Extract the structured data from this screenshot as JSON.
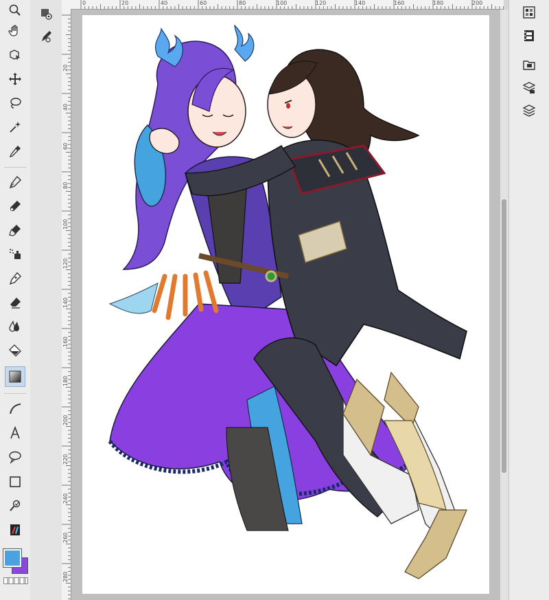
{
  "ruler": {
    "top_labels": [
      "0",
      "20",
      "40",
      "60",
      "80",
      "100",
      "120",
      "140",
      "160",
      "180",
      "200"
    ],
    "left_labels": [
      "20",
      "40",
      "60",
      "80",
      "100",
      "120",
      "140",
      "160",
      "180",
      "200",
      "220",
      "240",
      "260",
      "280"
    ]
  },
  "colors": {
    "main": "#4aa3e0",
    "sub": "#8a48d8",
    "toolbar_bg": "#ececec",
    "canvas_bg": "#bfbfbf"
  },
  "tools": [
    {
      "name": "zoom-icon"
    },
    {
      "name": "hand-icon"
    },
    {
      "name": "object-select-icon"
    },
    {
      "name": "move-icon"
    },
    {
      "name": "lasso-icon"
    },
    {
      "name": "magic-wand-icon"
    },
    {
      "name": "eyedropper-icon"
    },
    {
      "name": "pen-icon"
    },
    {
      "name": "pencil-icon"
    },
    {
      "name": "brush-icon"
    },
    {
      "name": "airbrush-icon"
    },
    {
      "name": "decoration-icon"
    },
    {
      "name": "eraser-icon"
    },
    {
      "name": "blend-icon"
    },
    {
      "name": "fill-icon"
    },
    {
      "name": "gradient-icon"
    },
    {
      "name": "figure-icon"
    },
    {
      "name": "text-icon"
    },
    {
      "name": "balloon-icon"
    },
    {
      "name": "frame-icon"
    },
    {
      "name": "correct-line-icon"
    },
    {
      "name": "palette-icon"
    }
  ],
  "artwork": {
    "description_alt": "Illustration of two characters dancing"
  }
}
